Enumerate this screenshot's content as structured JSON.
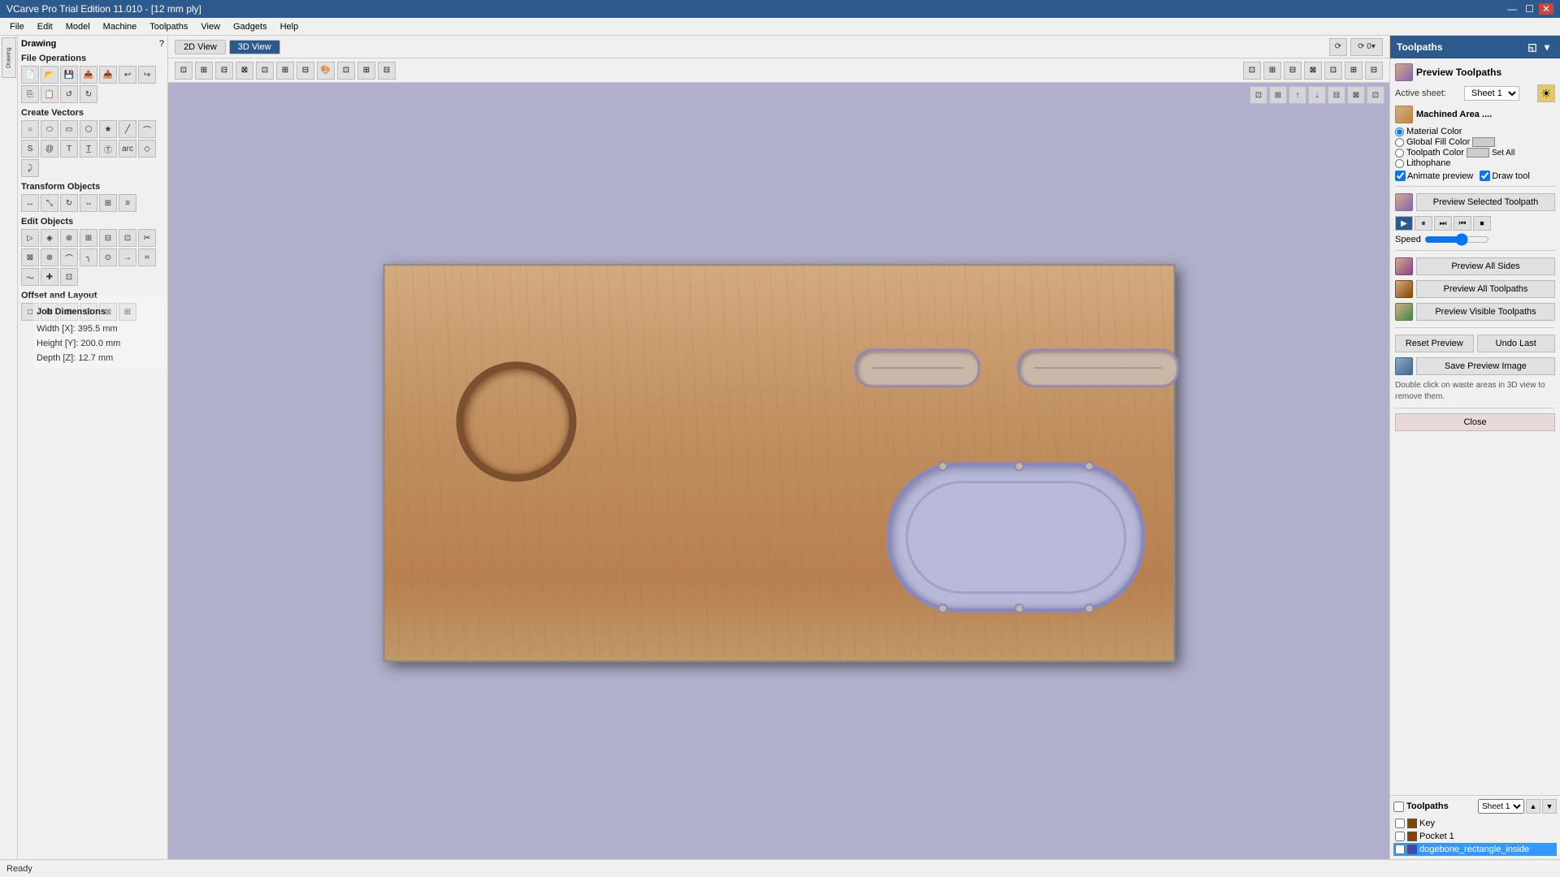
{
  "titlebar": {
    "title": "VCarve Pro Trial Edition 11.010 - [12 mm ply]",
    "controls": [
      "—",
      "☐",
      "✕"
    ]
  },
  "menubar": {
    "items": [
      "File",
      "Edit",
      "Model",
      "Machine",
      "Toolpaths",
      "View",
      "Gadgets",
      "Help"
    ]
  },
  "view_tabs": {
    "tab_2d": "2D View",
    "tab_3d": "3D View",
    "active": "3D View"
  },
  "left_panel": {
    "drawing_label": "Drawing",
    "sections": {
      "file_operations": "File Operations",
      "create_vectors": "Create Vectors",
      "transform_objects": "Transform Objects",
      "edit_objects": "Edit Objects",
      "offset_and_layout": "Offset and Layout"
    }
  },
  "job_dimensions": {
    "title": "Job Dimensions",
    "width_label": "Width  [X]:",
    "width_value": "395.5 mm",
    "height_label": "Height [Y]:",
    "height_value": "200.0 mm",
    "depth_label": "Depth  [Z]:",
    "depth_value": "12.7 mm"
  },
  "right_panel": {
    "header_title": "Toolpaths",
    "preview_section": {
      "title": "Preview Toolpaths",
      "active_sheet_label": "Active sheet:",
      "sheet_value": "Sheet 1",
      "machined_area_title": "Machined Area ....",
      "color_options": {
        "material_color": "Material Color",
        "global_fill_color": "Global Fill Color",
        "toolpath_color": "Toolpath Color",
        "lithophane": "Lithophane"
      },
      "animate_preview": "Animate preview",
      "draw_tool": "Draw tool",
      "preview_selected_label": "Preview Selected Toolpath",
      "speed_label": "Speed",
      "preview_all_sides": "Preview All Sides",
      "preview_all_toolpaths": "Preview All Toolpaths",
      "preview_visible_toolpaths": "Preview Visible Toolpaths",
      "reset_preview": "Reset Preview",
      "undo_last": "Undo Last",
      "save_preview_image": "Save Preview Image",
      "info_text": "Double click on waste areas in 3D view to remove them.",
      "close_label": "Close"
    },
    "toolpaths_section": {
      "title": "Toolpaths",
      "sheet_value": "Sheet 1",
      "items": [
        {
          "id": 1,
          "name": "Key",
          "checked": false,
          "color": "brown"
        },
        {
          "id": 2,
          "name": "Pocket 1",
          "checked": false,
          "color": "brown"
        },
        {
          "id": 3,
          "name": "dogebone_rectangle_inside",
          "checked": false,
          "color": "blue",
          "selected": true
        }
      ]
    }
  },
  "status_bar": {
    "text": "Ready"
  }
}
